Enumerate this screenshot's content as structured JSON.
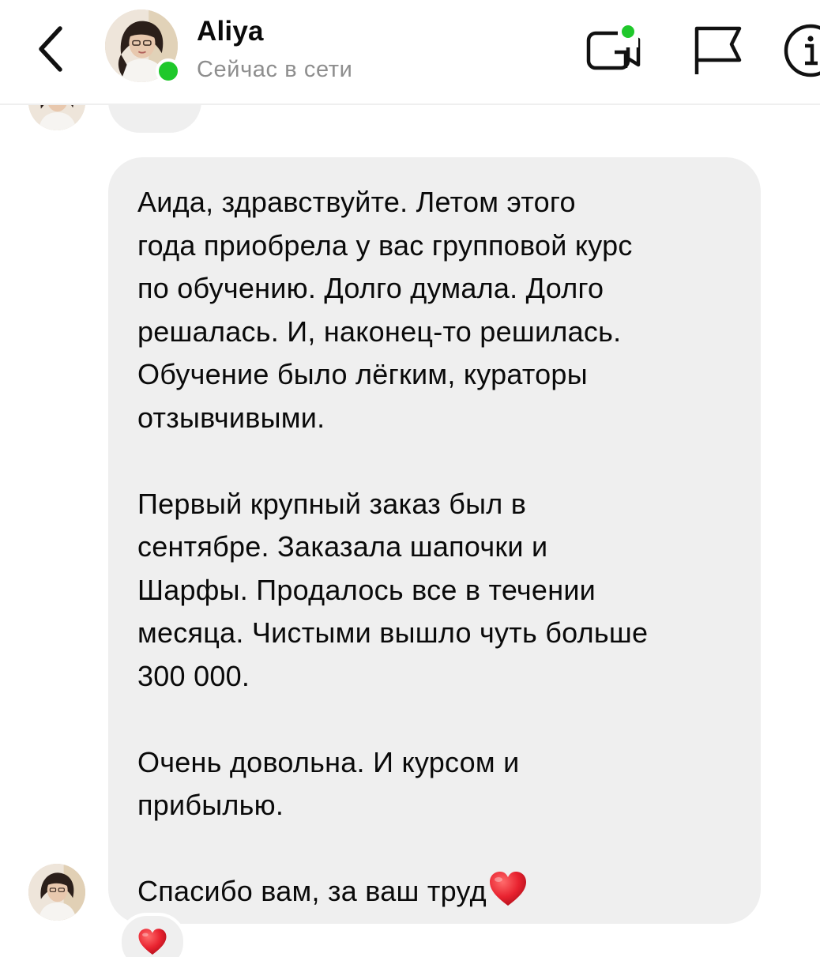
{
  "header": {
    "back_icon": "chevron-left-icon",
    "contact_name": "Aliya",
    "status_text": "Сейчас в сети",
    "online": true,
    "icons": [
      "video-call-icon",
      "flag-icon",
      "info-icon"
    ],
    "accent_online": "#1fc82b"
  },
  "conversation": {
    "message": {
      "paragraphs": [
        "Аида, здравствуйте. Летом этого\nгода приобрела у вас групповой курс\nпо обучению. Долго думала. Долго\nрешалась. И, наконец-то решилась.\nОбучение было лёгким, кураторы\nотзывчивыми.",
        "Первый крупный заказ был в\nсентябре. Заказала шапочки и\nШарфы. Продалось все в течении\nмесяца. Чистыми вышло чуть больше\n300 000.",
        "Очень довольна. И курсом и\nприбылью.",
        "Спасибо вам, за ваш труд"
      ],
      "trailing_emoji": "red-heart-icon",
      "bubble_color": "#efefef"
    },
    "reaction": {
      "emoji": "red-heart-icon"
    }
  }
}
